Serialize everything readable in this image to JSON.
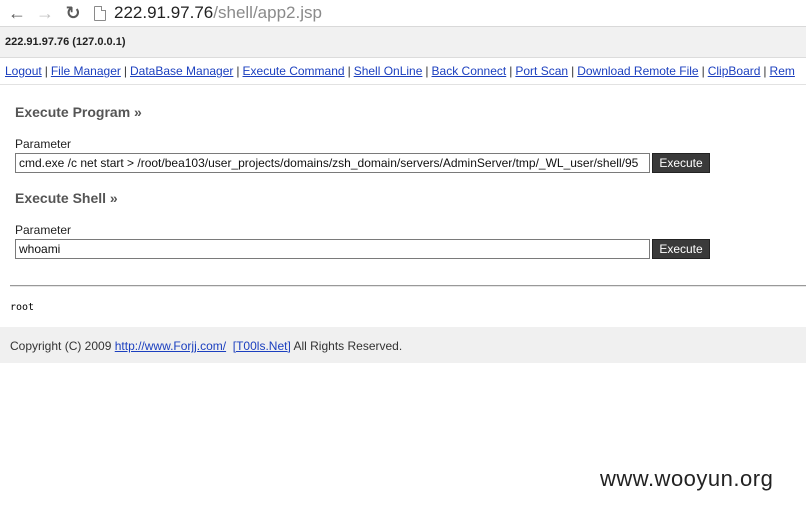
{
  "browser": {
    "url_host": "222.91.97.76",
    "url_path": "/shell/app2.jsp"
  },
  "header": {
    "host_info": "222.91.97.76 (127.0.0.1)"
  },
  "nav": {
    "links": [
      "Logout",
      "File Manager",
      "DataBase Manager",
      "Execute Command",
      "Shell OnLine",
      "Back Connect",
      "Port Scan",
      "Download Remote File",
      "ClipBoard",
      "Rem"
    ],
    "separator": "|"
  },
  "execute_program": {
    "title": "Execute Program »",
    "param_label": "Parameter",
    "value": "cmd.exe /c net start > /root/bea103/user_projects/domains/zsh_domain/servers/AdminServer/tmp/_WL_user/shell/95",
    "button": "Execute"
  },
  "execute_shell": {
    "title": "Execute Shell »",
    "param_label": "Parameter",
    "value": "whoami",
    "button": "Execute"
  },
  "output": "root",
  "footer": {
    "prefix": "Copyright (C) 2009",
    "link1": "http://www.Forjj.com/",
    "link2": "[T00ls.Net]",
    "suffix": "All Rights Reserved."
  },
  "watermark": "www.wooyun.org"
}
